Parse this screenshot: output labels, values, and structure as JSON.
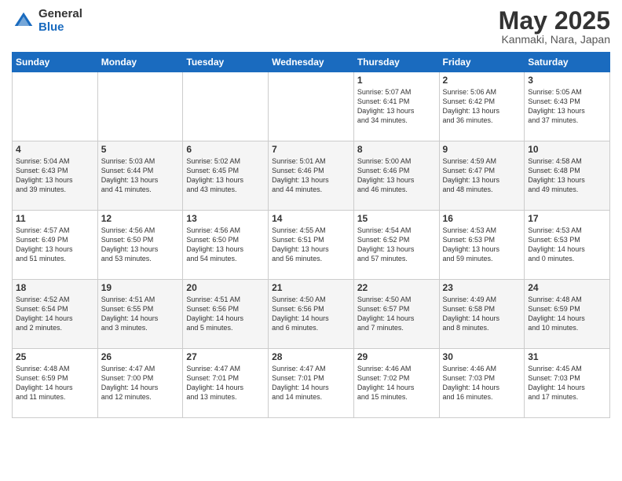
{
  "header": {
    "logo_general": "General",
    "logo_blue": "Blue",
    "month_title": "May 2025",
    "location": "Kanmaki, Nara, Japan"
  },
  "days_of_week": [
    "Sunday",
    "Monday",
    "Tuesday",
    "Wednesday",
    "Thursday",
    "Friday",
    "Saturday"
  ],
  "weeks": [
    [
      {
        "day": "",
        "info": ""
      },
      {
        "day": "",
        "info": ""
      },
      {
        "day": "",
        "info": ""
      },
      {
        "day": "",
        "info": ""
      },
      {
        "day": "1",
        "info": "Sunrise: 5:07 AM\nSunset: 6:41 PM\nDaylight: 13 hours\nand 34 minutes."
      },
      {
        "day": "2",
        "info": "Sunrise: 5:06 AM\nSunset: 6:42 PM\nDaylight: 13 hours\nand 36 minutes."
      },
      {
        "day": "3",
        "info": "Sunrise: 5:05 AM\nSunset: 6:43 PM\nDaylight: 13 hours\nand 37 minutes."
      }
    ],
    [
      {
        "day": "4",
        "info": "Sunrise: 5:04 AM\nSunset: 6:43 PM\nDaylight: 13 hours\nand 39 minutes."
      },
      {
        "day": "5",
        "info": "Sunrise: 5:03 AM\nSunset: 6:44 PM\nDaylight: 13 hours\nand 41 minutes."
      },
      {
        "day": "6",
        "info": "Sunrise: 5:02 AM\nSunset: 6:45 PM\nDaylight: 13 hours\nand 43 minutes."
      },
      {
        "day": "7",
        "info": "Sunrise: 5:01 AM\nSunset: 6:46 PM\nDaylight: 13 hours\nand 44 minutes."
      },
      {
        "day": "8",
        "info": "Sunrise: 5:00 AM\nSunset: 6:46 PM\nDaylight: 13 hours\nand 46 minutes."
      },
      {
        "day": "9",
        "info": "Sunrise: 4:59 AM\nSunset: 6:47 PM\nDaylight: 13 hours\nand 48 minutes."
      },
      {
        "day": "10",
        "info": "Sunrise: 4:58 AM\nSunset: 6:48 PM\nDaylight: 13 hours\nand 49 minutes."
      }
    ],
    [
      {
        "day": "11",
        "info": "Sunrise: 4:57 AM\nSunset: 6:49 PM\nDaylight: 13 hours\nand 51 minutes."
      },
      {
        "day": "12",
        "info": "Sunrise: 4:56 AM\nSunset: 6:50 PM\nDaylight: 13 hours\nand 53 minutes."
      },
      {
        "day": "13",
        "info": "Sunrise: 4:56 AM\nSunset: 6:50 PM\nDaylight: 13 hours\nand 54 minutes."
      },
      {
        "day": "14",
        "info": "Sunrise: 4:55 AM\nSunset: 6:51 PM\nDaylight: 13 hours\nand 56 minutes."
      },
      {
        "day": "15",
        "info": "Sunrise: 4:54 AM\nSunset: 6:52 PM\nDaylight: 13 hours\nand 57 minutes."
      },
      {
        "day": "16",
        "info": "Sunrise: 4:53 AM\nSunset: 6:53 PM\nDaylight: 13 hours\nand 59 minutes."
      },
      {
        "day": "17",
        "info": "Sunrise: 4:53 AM\nSunset: 6:53 PM\nDaylight: 14 hours\nand 0 minutes."
      }
    ],
    [
      {
        "day": "18",
        "info": "Sunrise: 4:52 AM\nSunset: 6:54 PM\nDaylight: 14 hours\nand 2 minutes."
      },
      {
        "day": "19",
        "info": "Sunrise: 4:51 AM\nSunset: 6:55 PM\nDaylight: 14 hours\nand 3 minutes."
      },
      {
        "day": "20",
        "info": "Sunrise: 4:51 AM\nSunset: 6:56 PM\nDaylight: 14 hours\nand 5 minutes."
      },
      {
        "day": "21",
        "info": "Sunrise: 4:50 AM\nSunset: 6:56 PM\nDaylight: 14 hours\nand 6 minutes."
      },
      {
        "day": "22",
        "info": "Sunrise: 4:50 AM\nSunset: 6:57 PM\nDaylight: 14 hours\nand 7 minutes."
      },
      {
        "day": "23",
        "info": "Sunrise: 4:49 AM\nSunset: 6:58 PM\nDaylight: 14 hours\nand 8 minutes."
      },
      {
        "day": "24",
        "info": "Sunrise: 4:48 AM\nSunset: 6:59 PM\nDaylight: 14 hours\nand 10 minutes."
      }
    ],
    [
      {
        "day": "25",
        "info": "Sunrise: 4:48 AM\nSunset: 6:59 PM\nDaylight: 14 hours\nand 11 minutes."
      },
      {
        "day": "26",
        "info": "Sunrise: 4:47 AM\nSunset: 7:00 PM\nDaylight: 14 hours\nand 12 minutes."
      },
      {
        "day": "27",
        "info": "Sunrise: 4:47 AM\nSunset: 7:01 PM\nDaylight: 14 hours\nand 13 minutes."
      },
      {
        "day": "28",
        "info": "Sunrise: 4:47 AM\nSunset: 7:01 PM\nDaylight: 14 hours\nand 14 minutes."
      },
      {
        "day": "29",
        "info": "Sunrise: 4:46 AM\nSunset: 7:02 PM\nDaylight: 14 hours\nand 15 minutes."
      },
      {
        "day": "30",
        "info": "Sunrise: 4:46 AM\nSunset: 7:03 PM\nDaylight: 14 hours\nand 16 minutes."
      },
      {
        "day": "31",
        "info": "Sunrise: 4:45 AM\nSunset: 7:03 PM\nDaylight: 14 hours\nand 17 minutes."
      }
    ]
  ]
}
